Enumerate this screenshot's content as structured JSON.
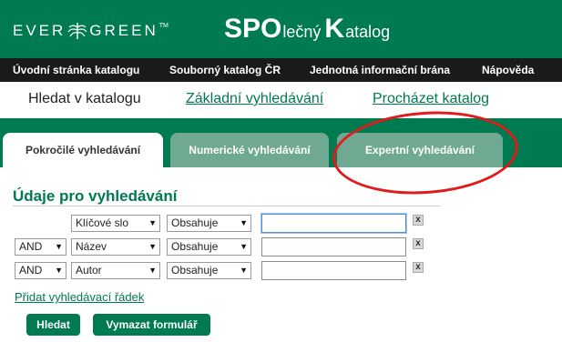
{
  "header": {
    "logo_left": "EVER",
    "logo_right": "GREEN",
    "logo_tm": "TM",
    "title_part1": "SPO",
    "title_part2": "lečný",
    "title_part3": "K",
    "title_part4": "atalog"
  },
  "topnav": {
    "items": [
      {
        "label": "Úvodní stránka katalogu"
      },
      {
        "label": "Souborný katalog ČR"
      },
      {
        "label": "Jednotná informační brána"
      },
      {
        "label": "Nápověda"
      }
    ]
  },
  "search_links": {
    "current": "Hledat v katalogu",
    "basic": "Základní vyhledávání",
    "browse": "Procházet katalog"
  },
  "tabs": [
    {
      "label": "Pokročilé vyhledávání",
      "active": true
    },
    {
      "label": "Numerické vyhledávání",
      "active": false
    },
    {
      "label": "Expertní vyhledávání",
      "active": false
    }
  ],
  "form": {
    "title": "Údaje pro vyhledávání",
    "rows": [
      {
        "bool": "",
        "field": "Klíčové slo",
        "op": "Obsahuje",
        "value": ""
      },
      {
        "bool": "AND",
        "field": "Název",
        "op": "Obsahuje",
        "value": ""
      },
      {
        "bool": "AND",
        "field": "Autor",
        "op": "Obsahuje",
        "value": ""
      }
    ],
    "remove_glyph": "x",
    "add_row": "Přidat vyhledávací řádek",
    "search_button": "Hledat",
    "clear_button": "Vymazat formulář"
  },
  "colors": {
    "brand_green": "#007a50",
    "nav_black": "#1a1a1a",
    "inactive_tab": "#6fa991",
    "annotation_red": "#e01b1b"
  },
  "icons": {
    "logo_leaf": "evergreen-leaf-icon",
    "dropdown": "triangle-down-icon",
    "remove": "close-x-icon"
  }
}
